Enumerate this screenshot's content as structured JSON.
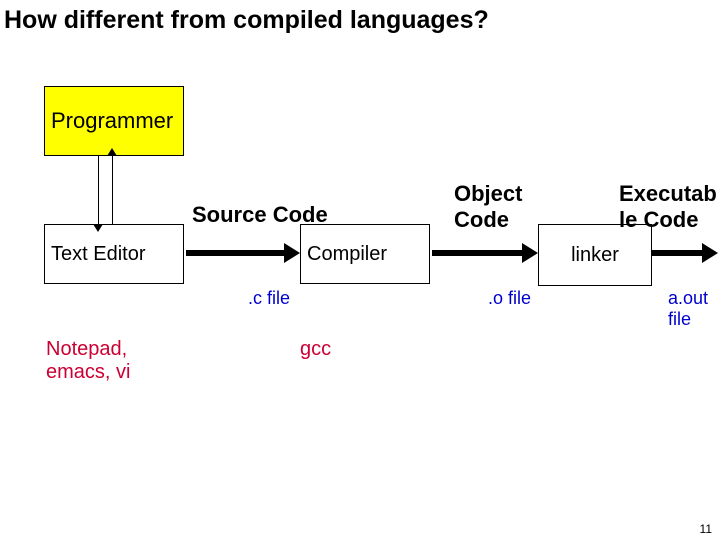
{
  "title": "How different from compiled languages?",
  "boxes": {
    "programmer": "Programmer",
    "editor": "Text Editor",
    "compiler": "Compiler",
    "linker": "linker"
  },
  "labels": {
    "source_code": "Source Code",
    "object_code": "Object\nCode",
    "exec_code": "Executab\nle Code"
  },
  "blue": {
    "c_file": ".c file",
    "o_file": ".o file",
    "aout_file": "a.out\nfile"
  },
  "red": {
    "editors": "Notepad,\nemacs, vi",
    "gcc": "gcc"
  },
  "page": "11"
}
